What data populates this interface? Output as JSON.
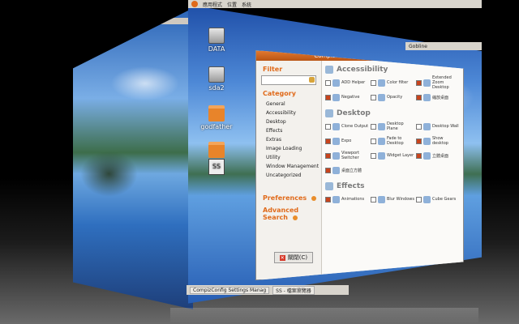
{
  "top_panel": {
    "menus": [
      "應用程式",
      "位置",
      "系統"
    ]
  },
  "right_panel": {
    "label": "Gobline"
  },
  "desktop_icons": [
    {
      "label": "DATA",
      "icon": "drive-icon"
    },
    {
      "label": "sda2",
      "icon": "drive-icon"
    },
    {
      "label": "godfather",
      "icon": "folder-icon"
    },
    {
      "label": "",
      "icon": "folder-icon"
    },
    {
      "label": "SS",
      "icon": "image-icon"
    }
  ],
  "ccsm": {
    "title": "CompizConfig Settings Manager",
    "filter_label": "Filter",
    "filter_value": "",
    "category_label": "Category",
    "categories": [
      "General",
      "Accessibility",
      "Desktop",
      "Effects",
      "Extras",
      "Image Loading",
      "Utility",
      "Window Management",
      "Uncategorized"
    ],
    "preferences_label": "Preferences",
    "advanced_search_label": "Advanced Search",
    "close_label": "關閉(C)",
    "groups": [
      {
        "title": "Accessibility",
        "plugins": [
          {
            "name": "ADD Helper",
            "checked": false
          },
          {
            "name": "Color filter",
            "checked": false
          },
          {
            "name": "Extended Zoom Desktop",
            "checked": true
          },
          {
            "name": "Negative",
            "checked": true
          },
          {
            "name": "Opacity",
            "checked": false
          },
          {
            "name": "縮放桌面",
            "checked": true
          }
        ]
      },
      {
        "title": "Desktop",
        "plugins": [
          {
            "name": "Clone Output",
            "checked": false
          },
          {
            "name": "Desktop Plane",
            "checked": false
          },
          {
            "name": "Desktop Wall",
            "checked": false
          },
          {
            "name": "Expo",
            "checked": true
          },
          {
            "name": "Fade to Desktop",
            "checked": false
          },
          {
            "name": "Show desktop",
            "checked": true
          },
          {
            "name": "Viewport Switcher",
            "checked": true
          },
          {
            "name": "Widget Layer",
            "checked": false
          },
          {
            "name": "立體桌面",
            "checked": true
          },
          {
            "name": "桌面立方體",
            "checked": true
          }
        ]
      },
      {
        "title": "Effects",
        "plugins": [
          {
            "name": "Animations",
            "checked": true
          },
          {
            "name": "Blur Windows",
            "checked": false
          },
          {
            "name": "Cube Gears",
            "checked": false
          }
        ]
      }
    ]
  },
  "taskbar": {
    "items": [
      "CompizConfig Settings Manag",
      "SS - 檔案瀏覽器"
    ]
  }
}
